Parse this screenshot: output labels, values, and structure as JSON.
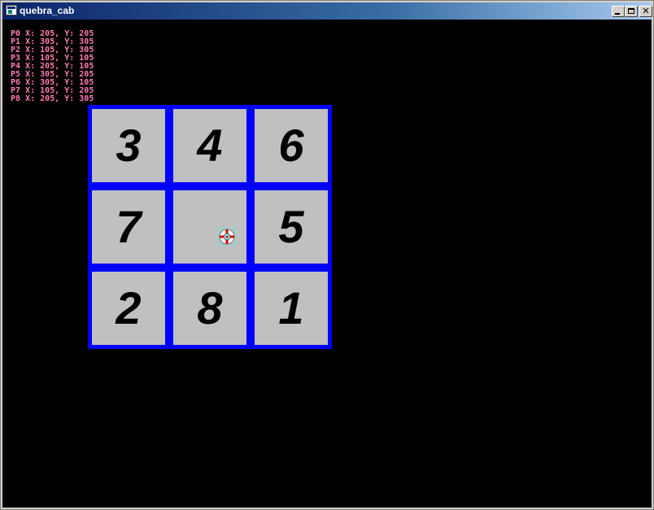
{
  "window": {
    "title": "quebra_cab",
    "buttons": {
      "minimize": "minimize",
      "maximize": "maximize",
      "close": "✕"
    }
  },
  "debug_lines": [
    "P0 X: 205, Y: 205",
    "P1 X: 305, Y: 305",
    "P2 X: 105, Y: 305",
    "P3 X: 105, Y: 105",
    "P4 X: 205, Y: 105",
    "P5 X: 305, Y: 205",
    "P6 X: 305, Y: 105",
    "P7 X: 105, Y: 205",
    "P8 X: 205, Y: 305"
  ],
  "puzzle": {
    "rows": 3,
    "cols": 3,
    "grid": [
      [
        "3",
        "4",
        "6"
      ],
      [
        "7",
        "",
        "5"
      ],
      [
        "2",
        "8",
        "1"
      ]
    ],
    "empty_cell": {
      "row": 1,
      "col": 1
    }
  },
  "colors": {
    "background": "#000000",
    "board_border": "#0000ff",
    "tile": "#c0c0c0",
    "tile_text": "#000000",
    "debug_text": "#ff7ab8"
  },
  "cursor": {
    "icon": "lifebuoy-cursor-icon"
  }
}
